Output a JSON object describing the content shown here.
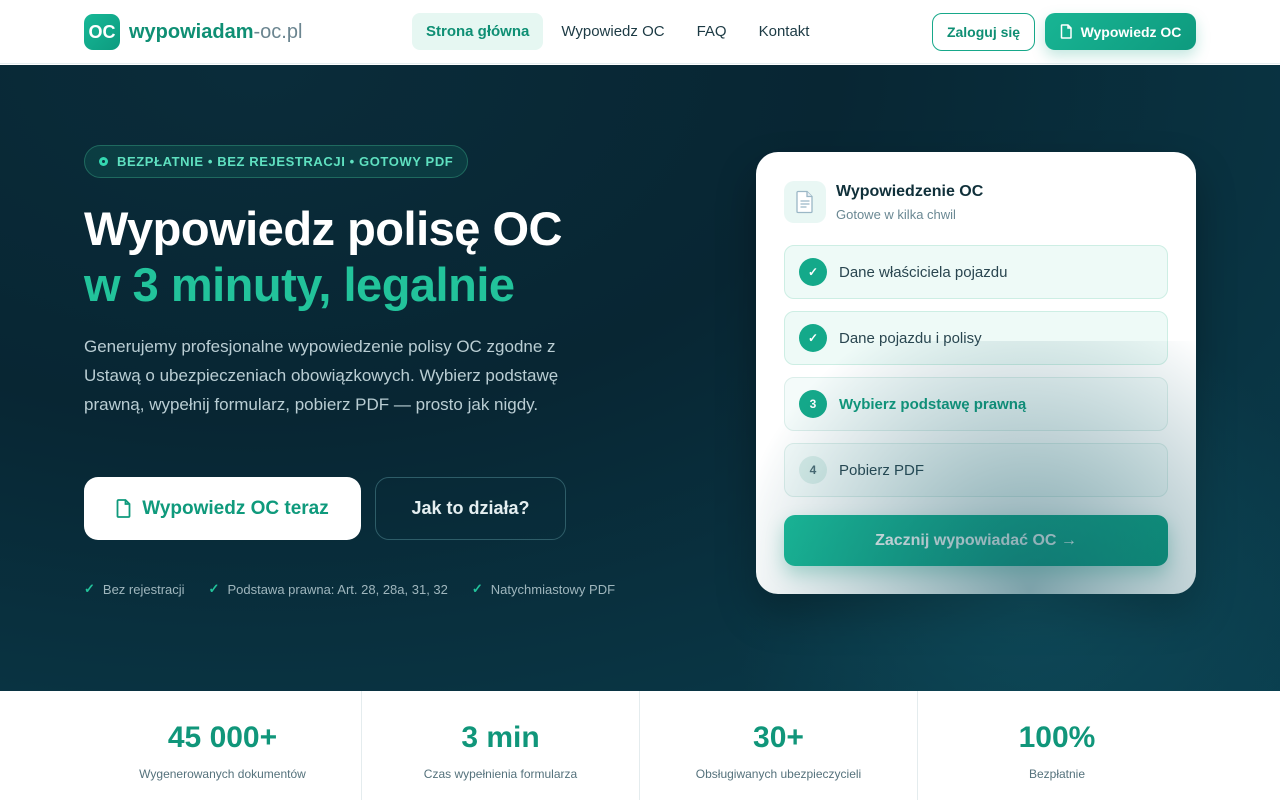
{
  "nav": {
    "logo_badge": "OC",
    "logo_main": "wypowiadam",
    "logo_sub": "-oc.pl",
    "items": [
      {
        "label": "Strona główna",
        "active": true
      },
      {
        "label": "Wypowiedz OC",
        "active": false
      },
      {
        "label": "FAQ",
        "active": false
      },
      {
        "label": "Kontakt",
        "active": false
      }
    ],
    "login_label": "Zaloguj się",
    "cta_label": "Wypowiedz OC",
    "cta_icon": "document-icon"
  },
  "hero": {
    "pill_text": "BEZPŁATNIE • BEZ REJESTRACJI • GOTOWY PDF",
    "title_line1": "Wypowiedz polisę OC",
    "title_line2": "w 3 minuty, legalnie",
    "lead": "Generujemy profesjonalne wypowiedzenie polisy OC zgodne z Ustawą o ubezpieczeniach obowiązkowych. Wybierz podstawę prawną, wypełnij formularz, pobierz PDF — prosto jak nigdy.",
    "primary_cta": "Wypowiedz OC teraz",
    "secondary_cta": "Jak to działa?",
    "checks": [
      "Bez rejestracji",
      "Podstawa prawna: Art. 28, 28a, 31, 32",
      "Natychmiastowy PDF"
    ]
  },
  "card": {
    "title": "Wypowiedzenie OC",
    "subtitle": "Gotowe w kilka chwil",
    "steps": [
      {
        "badge": "✓",
        "label": "Dane właściciela pojazdu",
        "state": "done"
      },
      {
        "badge": "✓",
        "label": "Dane pojazdu i polisy",
        "state": "done"
      },
      {
        "badge": "3",
        "label": "Wybierz podstawę prawną",
        "state": "current"
      },
      {
        "badge": "4",
        "label": "Pobierz PDF",
        "state": "todo"
      }
    ],
    "cta_label": "Zacznij wypowiadać OC →"
  },
  "stats": [
    {
      "value": "45 000+",
      "label": "Wygenerowanych dokumentów"
    },
    {
      "value": "3 min",
      "label": "Czas wypełnienia formularza"
    },
    {
      "value": "30+",
      "label": "Obsługiwanych ubezpieczycieli"
    },
    {
      "value": "100%",
      "label": "Bezpłatnie"
    }
  ],
  "colors": {
    "accent": "#14a98a",
    "hero_bg": "#082633",
    "accent_light": "#22c39b"
  }
}
